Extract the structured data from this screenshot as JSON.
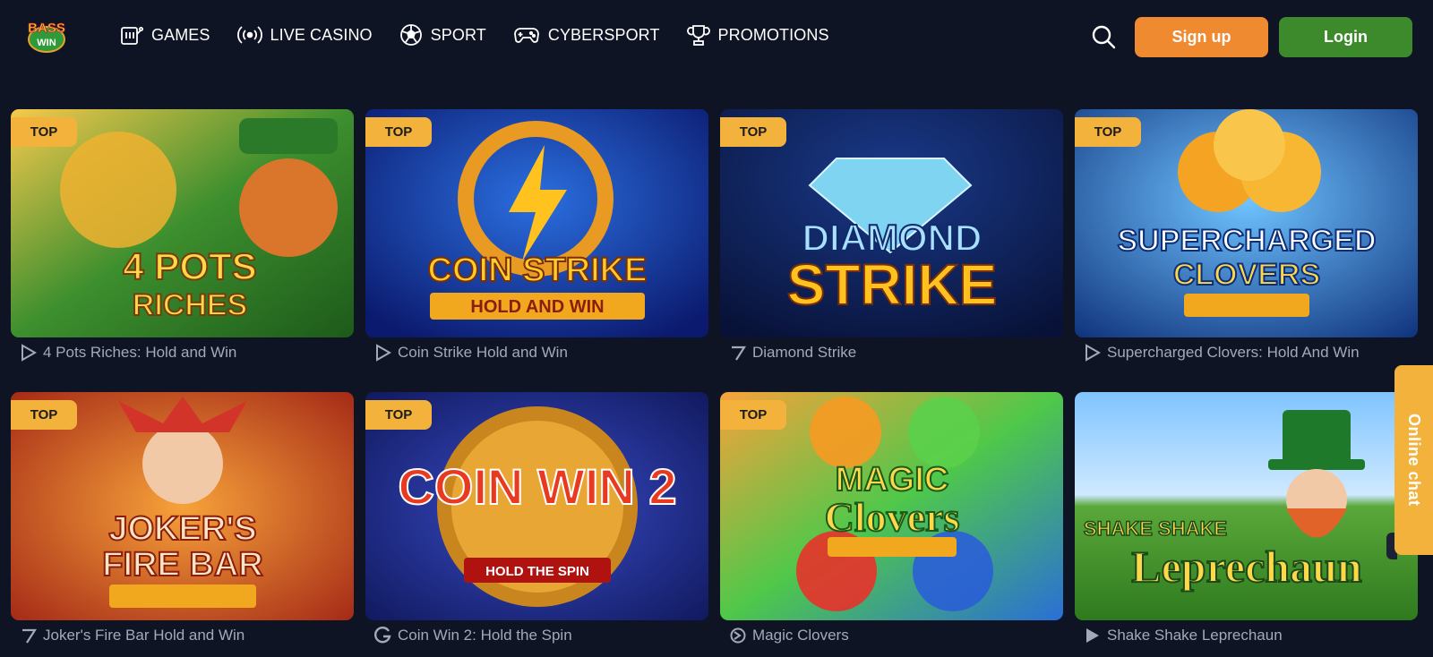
{
  "brand": {
    "logo_top": "BASS",
    "logo_bottom": "WIN"
  },
  "nav": [
    {
      "label": "GAMES",
      "icon": "slot-machine-icon"
    },
    {
      "label": "LIVE CASINO",
      "icon": "broadcast-icon"
    },
    {
      "label": "SPORT",
      "icon": "soccer-ball-icon"
    },
    {
      "label": "CYBERSPORT",
      "icon": "gamepad-icon"
    },
    {
      "label": "PROMOTIONS",
      "icon": "trophy-icon"
    }
  ],
  "header": {
    "signup_label": "Sign up",
    "login_label": "Login"
  },
  "colors": {
    "background": "#0f1424",
    "signup": "#f08a30",
    "login": "#3c8a2c",
    "badge": "#f3b23c"
  },
  "games": [
    {
      "badge": "TOP",
      "title": "4 Pots Riches: Hold and Win",
      "provider_icon": "play-triangle-icon",
      "art_top": "4 POTS",
      "art_bottom": "RICHES"
    },
    {
      "badge": "TOP",
      "title": "Coin Strike Hold and Win",
      "provider_icon": "play-triangle-icon",
      "art_top": "COIN STRIKE",
      "art_bottom": "HOLD AND WIN"
    },
    {
      "badge": "TOP",
      "title": "Diamond Strike",
      "provider_icon": "seven-icon",
      "art_top": "DIAMOND",
      "art_bottom": "STRIKE"
    },
    {
      "badge": "TOP",
      "title": "Supercharged Clovers: Hold And Win",
      "provider_icon": "play-triangle-icon",
      "art_top": "SUPERCHARGED",
      "art_bottom": "CLOVERS"
    },
    {
      "badge": "TOP",
      "title": "Joker's Fire Bar Hold and Win",
      "provider_icon": "seven-icon",
      "art_top": "JOKER'S",
      "art_bottom": "FIRE BAR"
    },
    {
      "badge": "TOP",
      "title": "Coin Win 2: Hold the Spin",
      "provider_icon": "g-logo-icon",
      "art_top": "COIN WIN 2",
      "art_bottom": "HOLD THE SPIN"
    },
    {
      "badge": "TOP",
      "title": "Magic Clovers",
      "provider_icon": "spiral-icon",
      "art_top": "MAGIC",
      "art_bottom": "Clovers"
    },
    {
      "badge": "",
      "title": "Shake Shake Leprechaun",
      "provider_icon": "play-triangle-icon",
      "art_top": "SHAKE SHAKE",
      "art_bottom": "Leprechaun"
    }
  ],
  "chat": {
    "label": "Online chat"
  }
}
